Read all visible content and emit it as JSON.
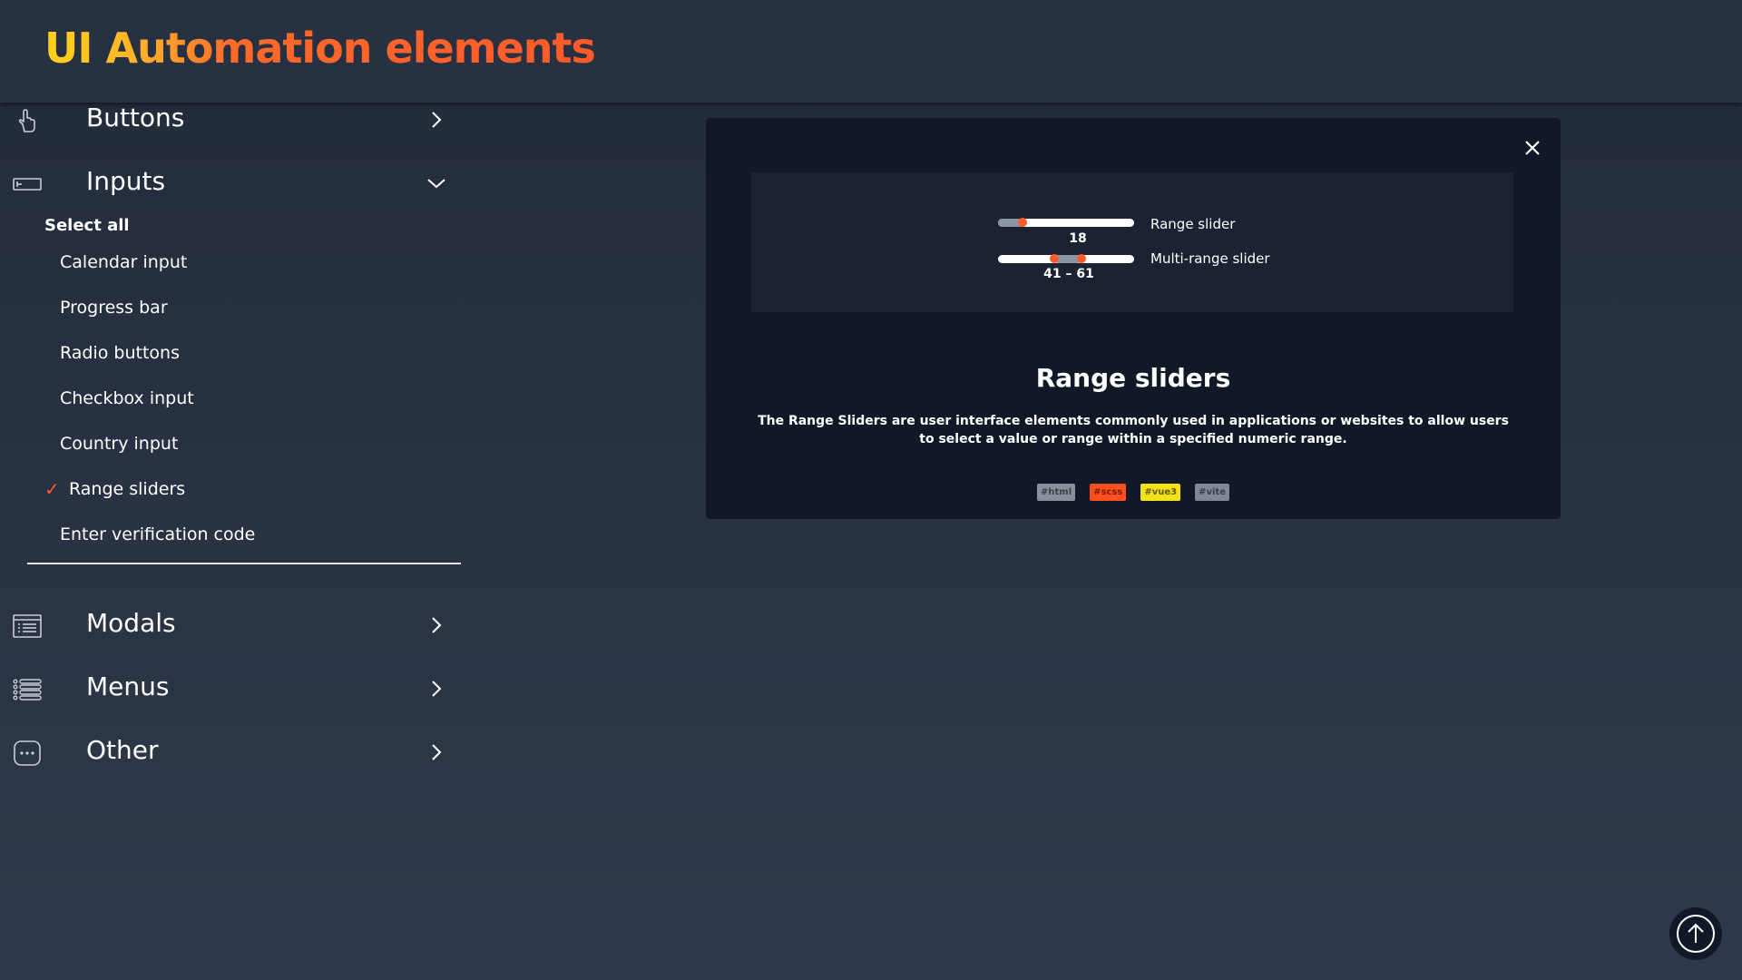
{
  "header": {
    "title": "UI Automation elements"
  },
  "sidebar": {
    "sections": [
      {
        "label": "Buttons",
        "icon": "pointing-hand-icon",
        "expanded": false
      },
      {
        "label": "Inputs",
        "icon": "input-field-icon",
        "expanded": true
      },
      {
        "label": "Modals",
        "icon": "modal-window-icon",
        "expanded": false
      },
      {
        "label": "Menus",
        "icon": "list-menu-icon",
        "expanded": false
      },
      {
        "label": "Other",
        "icon": "more-dots-icon",
        "expanded": false
      }
    ],
    "select_all": "Select all",
    "sub_items": [
      {
        "label": "Calendar input",
        "active": false
      },
      {
        "label": "Progress bar",
        "active": false
      },
      {
        "label": "Radio buttons",
        "active": false
      },
      {
        "label": "Checkbox input",
        "active": false
      },
      {
        "label": "Country input",
        "active": false
      },
      {
        "label": "Range sliders",
        "active": true
      },
      {
        "label": "Enter verification code",
        "active": false
      }
    ],
    "active_mark": "✓"
  },
  "card": {
    "range_slider": {
      "label": "Range slider",
      "value": "18",
      "value_num": 18,
      "min": 0,
      "max": 100
    },
    "multi_range_slider": {
      "label": "Multi-range slider",
      "value": "41 – 61",
      "low": 41,
      "high": 61,
      "min": 0,
      "max": 100
    },
    "title": "Range sliders",
    "description": "The Range Sliders are user interface elements commonly used in applications or websites to allow users to select a value or range within a specified numeric range.",
    "tags": [
      {
        "label": "#html",
        "bg": "#8a8f99",
        "fg": "#3a3f4a"
      },
      {
        "label": "#scss",
        "bg": "#ff4f1f",
        "fg": "#7a1b05"
      },
      {
        "label": "#vue3",
        "bg": "#f2e21a",
        "fg": "#6a5a00"
      },
      {
        "label": "#vite",
        "bg": "#808898",
        "fg": "#3a3f4a"
      }
    ]
  },
  "colors": {
    "accent": "#ff5a2a",
    "title_gradient_start": "#ffd21a",
    "card_bg": "#111827",
    "page_bg": "#2a3445"
  },
  "scroll_top": {
    "icon": "arrow-up-icon"
  }
}
